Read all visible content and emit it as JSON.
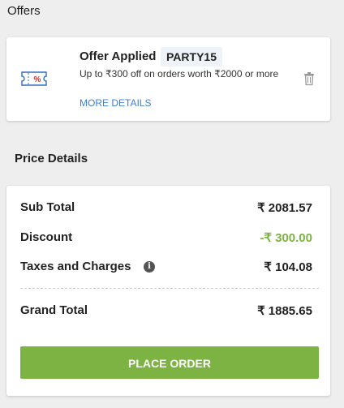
{
  "offers": {
    "section_title": "Offers",
    "title": "Offer Applied",
    "code": "PARTY15",
    "description": "Up to ₹300 off on orders worth ₹2000 or more",
    "more_details": "MORE DETAILS",
    "coupon_icon": "coupon-percent-icon",
    "remove_icon": "trash-icon"
  },
  "price_details": {
    "title": "Price Details",
    "rows": [
      {
        "label": "Sub Total",
        "value": "₹ 2081.57"
      },
      {
        "label": "Discount",
        "value": "-₹ 300.00"
      },
      {
        "label": "Taxes and Charges",
        "value": "₹ 104.08"
      }
    ],
    "grand_total": {
      "label": "Grand Total",
      "value": "₹ 1885.65"
    },
    "info_icon": "info-icon",
    "discount_color": "#7cb342"
  },
  "actions": {
    "place_order": "PLACE ORDER",
    "button_color": "#7cb342"
  }
}
